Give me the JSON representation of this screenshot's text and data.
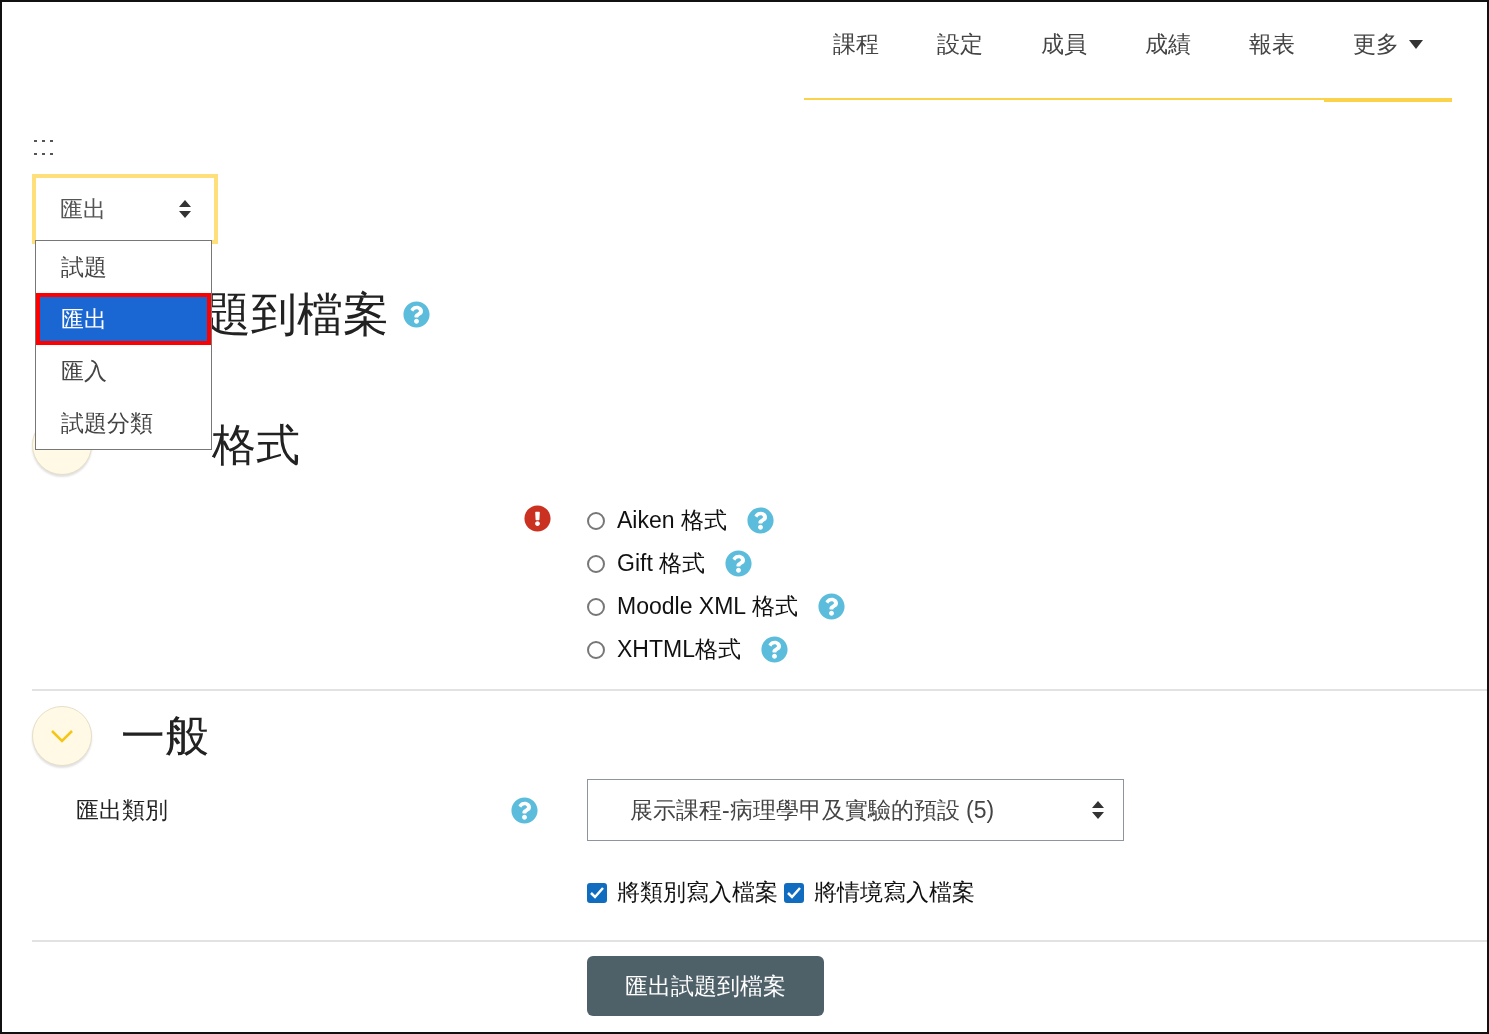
{
  "nav": {
    "tabs": [
      {
        "label": "課程",
        "selected": false,
        "dropdown": false
      },
      {
        "label": "設定",
        "selected": false,
        "dropdown": false
      },
      {
        "label": "成員",
        "selected": false,
        "dropdown": false
      },
      {
        "label": "成績",
        "selected": false,
        "dropdown": false
      },
      {
        "label": "報表",
        "selected": false,
        "dropdown": false
      },
      {
        "label": "更多",
        "selected": true,
        "dropdown": true
      }
    ]
  },
  "navigation_select": {
    "value": "匯出",
    "expanded": true,
    "options": [
      {
        "label": "試題",
        "selected": false
      },
      {
        "label": "匯出",
        "selected": true
      },
      {
        "label": "匯入",
        "selected": false
      },
      {
        "label": "試題分類",
        "selected": false
      }
    ]
  },
  "page_title": "題到檔案",
  "format_section": {
    "heading": "格式",
    "formats": [
      {
        "label": "Aiken 格式",
        "selected": false
      },
      {
        "label": "Gift 格式",
        "selected": false
      },
      {
        "label": "Moodle XML 格式",
        "selected": false
      },
      {
        "label": "XHTML格式",
        "selected": false
      }
    ]
  },
  "general_section": {
    "heading": "一般",
    "expanded": true,
    "category": {
      "label": "匯出類別",
      "value": "展示課程-病理學甲及實驗的預設 (5)"
    },
    "options": [
      {
        "label": "將類別寫入檔案",
        "checked": true
      },
      {
        "label": "將情境寫入檔案",
        "checked": true
      }
    ]
  },
  "submit_button": "匯出試題到檔案"
}
